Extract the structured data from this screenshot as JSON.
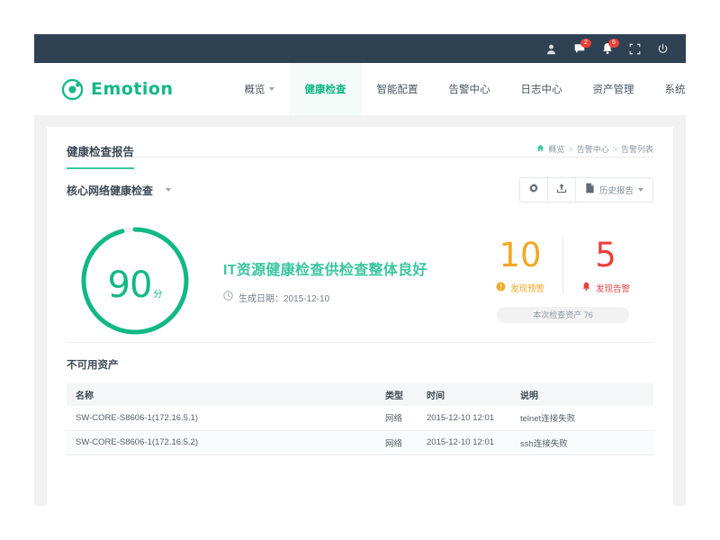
{
  "topbar": {
    "icons": [
      {
        "name": "user-icon",
        "badge": null
      },
      {
        "name": "message-icon",
        "badge": "2"
      },
      {
        "name": "bell-icon",
        "badge": "6"
      },
      {
        "name": "fullscreen-icon",
        "badge": null
      },
      {
        "name": "power-icon",
        "badge": null
      }
    ],
    "message_badge": "2",
    "bell_badge": "6"
  },
  "brand": {
    "name": "Emotion",
    "logo_icon": "circle-logo-icon",
    "color": "#12b886"
  },
  "nav": {
    "items": [
      {
        "label": "概览",
        "active": false,
        "has_dropdown": true
      },
      {
        "label": "健康检查",
        "active": true,
        "has_dropdown": false
      },
      {
        "label": "智能配置",
        "active": false,
        "has_dropdown": false
      },
      {
        "label": "告警中心",
        "active": false,
        "has_dropdown": false
      },
      {
        "label": "日志中心",
        "active": false,
        "has_dropdown": false
      },
      {
        "label": "资产管理",
        "active": false,
        "has_dropdown": false
      },
      {
        "label": "系统管理",
        "active": false,
        "has_dropdown": false
      }
    ]
  },
  "page_header": {
    "title": "健康检查报告",
    "breadcrumb": {
      "home_icon": "home-icon",
      "items": [
        "概览",
        "告警中心",
        "告警列表"
      ],
      "separator": ">"
    }
  },
  "filter_row": {
    "selected_check": "核心网络健康检查",
    "toolbar": {
      "settings_icon": "gear-icon",
      "export_icon": "upload-icon",
      "report_icon": "document-icon",
      "history_label": "历史报告"
    }
  },
  "summary": {
    "score": "90",
    "score_unit": "分",
    "score_percent": 90,
    "headline": "IT资源健康检查供检查整体良好",
    "date_icon": "clock-icon",
    "date_label": "生成日期：2015-12-10",
    "stats": [
      {
        "value": "10",
        "label": "发现预警",
        "icon": "exclamation-circle-icon",
        "color": "#f5a623"
      },
      {
        "value": "5",
        "label": "发现告警",
        "icon": "bell-icon",
        "color": "#e8413a"
      }
    ],
    "asset_pill": "本次检查资产 76"
  },
  "table_section": {
    "title": "不可用资产",
    "columns": [
      "名称",
      "类型",
      "时间",
      "说明"
    ],
    "rows": [
      {
        "name": "SW-CORE-S8606-1(172.16.5.1)",
        "type": "网络",
        "time": "2015-12-10 12:01",
        "desc": "telnet连接失败"
      },
      {
        "name": "SW-CORE-S8606-1(172.16.5.2)",
        "type": "网络",
        "time": "2015-12-10 12:01",
        "desc": "ssh连接失败"
      }
    ]
  }
}
